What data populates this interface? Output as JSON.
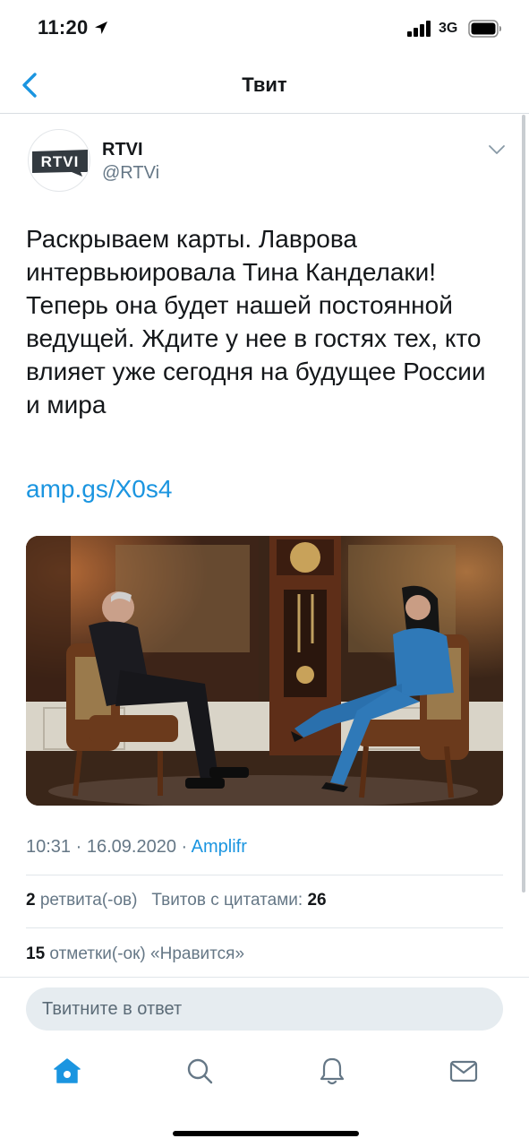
{
  "status_bar": {
    "time": "11:20",
    "network": "3G"
  },
  "nav": {
    "title": "Твит"
  },
  "tweet": {
    "author_name": "RTVI",
    "author_handle": "@RTVi",
    "avatar_text": "RTVI",
    "text": "Раскрываем карты. Лаврова интервьюировала Тина Канделаки! Теперь она будет нашей постоянной ведущей. Ждите у нее в гостях тех, кто влияет уже сегодня на будущее России и мира",
    "link": "amp.gs/X0s4",
    "time": "10:31",
    "date": "16.09.2020",
    "source": "Amplifr",
    "retweets_count": "2",
    "retweets_label": "ретвита(-ов)",
    "quotes_label": "Твитов с цитатами:",
    "quotes_count": "26",
    "likes_count": "15",
    "likes_label": "отметки(-ок) «Нравится»"
  },
  "reply": {
    "placeholder": "Твитните в ответ"
  },
  "tab_bar": {
    "items": [
      "home-icon",
      "search-icon",
      "notifications-icon",
      "messages-icon"
    ]
  },
  "colors": {
    "accent": "#1b95e0",
    "text": "#14171a",
    "secondary": "#657786"
  }
}
